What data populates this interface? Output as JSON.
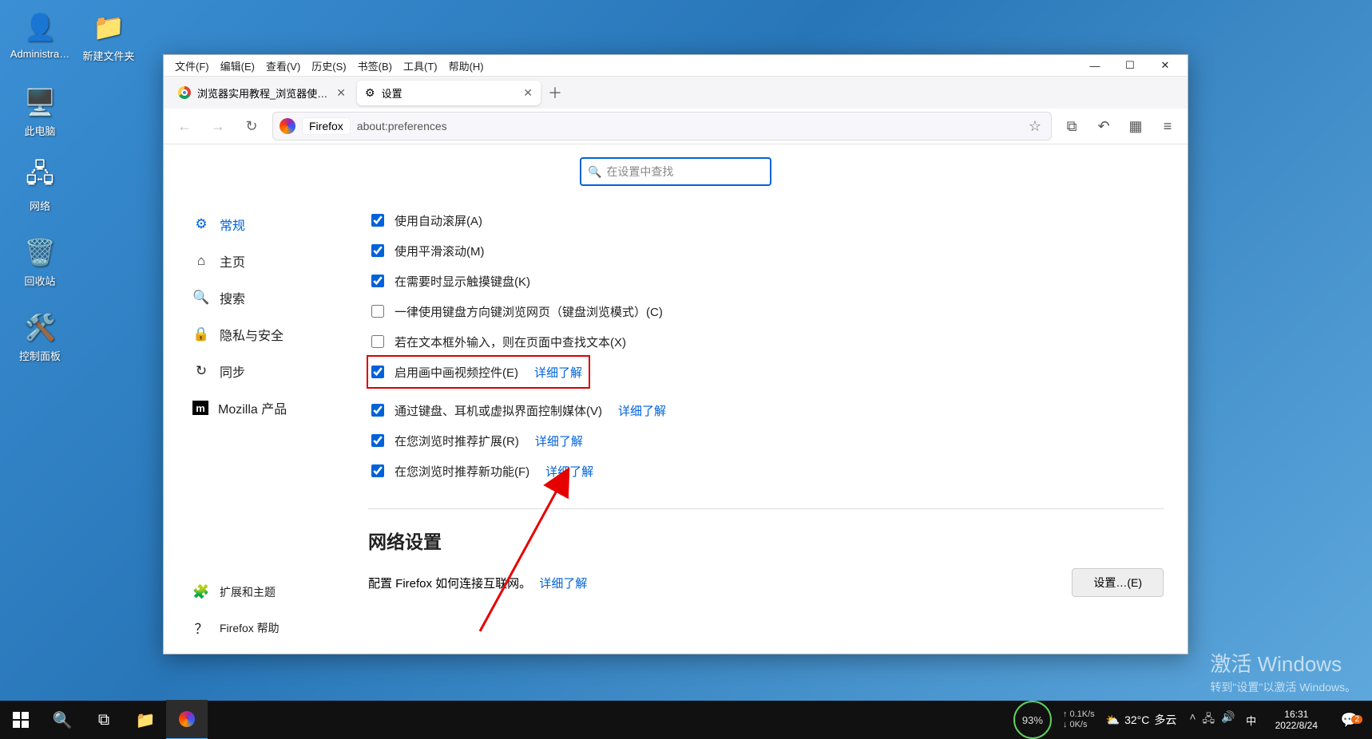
{
  "desktop": {
    "icons": [
      {
        "label": "Administra…",
        "glyph": "👤"
      },
      {
        "label": "此电脑",
        "glyph": "🖥️"
      },
      {
        "label": "网络",
        "glyph": "🖧"
      },
      {
        "label": "回收站",
        "glyph": "🗑️"
      },
      {
        "label": "控制面板",
        "glyph": "🛠️"
      }
    ],
    "icons_col2": [
      {
        "label": "新建文件夹",
        "glyph": "📁"
      }
    ]
  },
  "menubar": {
    "items": [
      "文件(F)",
      "编辑(E)",
      "查看(V)",
      "历史(S)",
      "书签(B)",
      "工具(T)",
      "帮助(H)"
    ]
  },
  "tabs": {
    "items": [
      {
        "title": "浏览器实用教程_浏览器使用方法",
        "active": false,
        "icon": "chrome"
      },
      {
        "title": "设置",
        "active": true,
        "icon": "gear"
      }
    ]
  },
  "urlbar": {
    "brand": "Firefox",
    "address": "about:preferences"
  },
  "search": {
    "placeholder": "在设置中查找"
  },
  "sidebar": {
    "items": [
      {
        "label": "常规",
        "icon": "⚙",
        "active": true
      },
      {
        "label": "主页",
        "icon": "⌂",
        "active": false
      },
      {
        "label": "搜索",
        "icon": "🔍",
        "active": false
      },
      {
        "label": "隐私与安全",
        "icon": "🔒",
        "active": false
      },
      {
        "label": "同步",
        "icon": "↻",
        "active": false
      },
      {
        "label": "Mozilla 产品",
        "icon": "m",
        "active": false
      }
    ],
    "footer": [
      {
        "label": "扩展和主题",
        "icon": "🧩"
      },
      {
        "label": "Firefox 帮助",
        "icon": "？"
      }
    ]
  },
  "options": [
    {
      "checked": true,
      "label": "使用自动滚屏(A)",
      "link": null,
      "unchk": false
    },
    {
      "checked": true,
      "label": "使用平滑滚动(M)",
      "link": null,
      "unchk": false
    },
    {
      "checked": true,
      "label": "在需要时显示触摸键盘(K)",
      "link": null,
      "unchk": false
    },
    {
      "checked": false,
      "label": "一律使用键盘方向键浏览网页（键盘浏览模式）(C)",
      "link": null,
      "unchk": true
    },
    {
      "checked": false,
      "label": "若在文本框外输入，则在页面中查找文本(X)",
      "link": null,
      "unchk": true
    },
    {
      "checked": true,
      "label": "启用画中画视频控件(E)",
      "link": "详细了解",
      "highlight": true
    },
    {
      "checked": true,
      "label": "通过键盘、耳机或虚拟界面控制媒体(V)",
      "link": "详细了解"
    },
    {
      "checked": true,
      "label": "在您浏览时推荐扩展(R)",
      "link": "详细了解"
    },
    {
      "checked": true,
      "label": "在您浏览时推荐新功能(F)",
      "link": "详细了解"
    }
  ],
  "network": {
    "title": "网络设置",
    "desc": "配置 Firefox 如何连接互联网。",
    "link": "详细了解",
    "button": "设置…(E)"
  },
  "watermark": {
    "line1": "激活 Windows",
    "line2": "转到\"设置\"以激活 Windows。"
  },
  "taskbar": {
    "battery": "93%",
    "netUp": "0.1K/s",
    "netDown": "0K/s",
    "weather_temp": "32°C",
    "weather_desc": "多云",
    "ime": "中",
    "time": "16:31",
    "date": "2022/8/24",
    "notif_count": "2"
  }
}
